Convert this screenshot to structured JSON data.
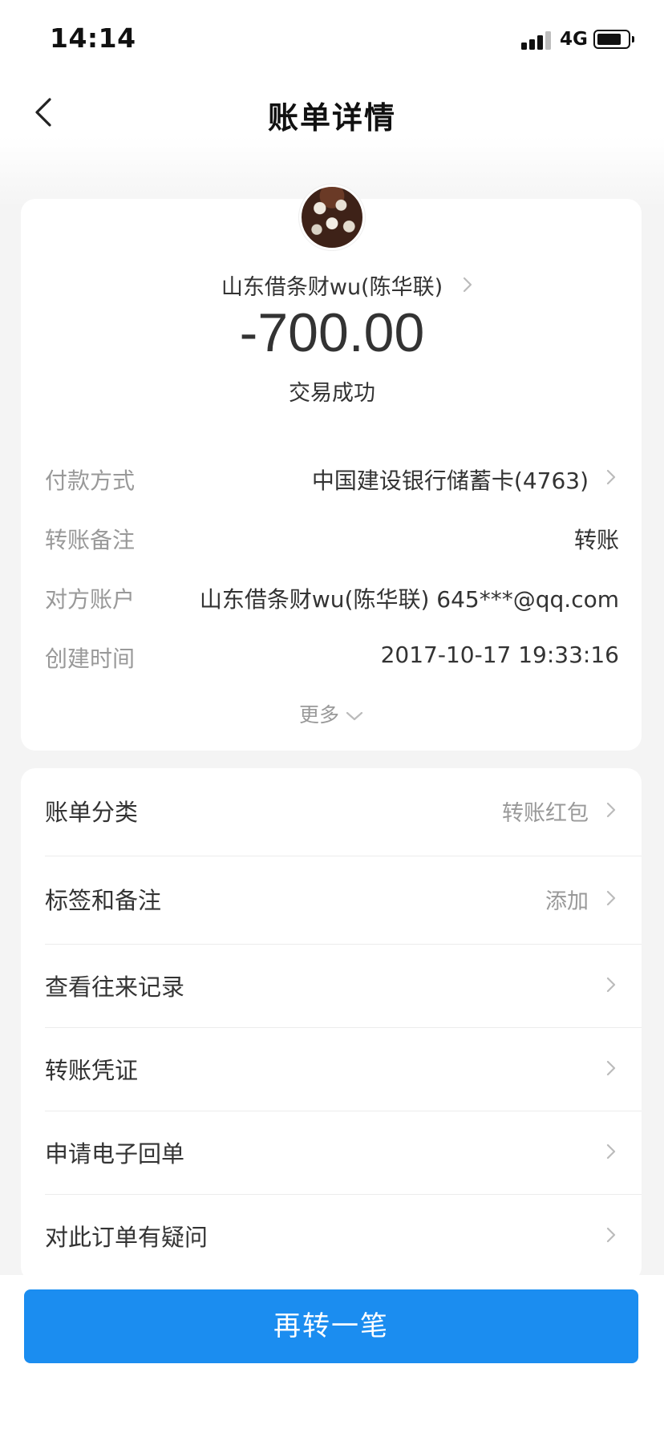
{
  "status_bar": {
    "time": "14:14",
    "network": "4G",
    "battery_icon": "battery-icon",
    "signal_icon": "signal-icon"
  },
  "nav": {
    "title": "账单详情",
    "back_icon": "chevron-left-icon"
  },
  "transaction": {
    "payee": "山东借条财wu(陈华联)",
    "amount": "-700.00",
    "status": "交易成功"
  },
  "details": [
    {
      "label": "付款方式",
      "value": "中国建设银行储蓄卡(4763)",
      "has_chevron": true
    },
    {
      "label": "转账备注",
      "value": "转账",
      "has_chevron": false
    },
    {
      "label": "对方账户",
      "value": "山东借条财wu(陈华联) 645***@qq.com",
      "has_chevron": false
    },
    {
      "label": "创建时间",
      "value": "2017-10-17 19:33:16",
      "has_chevron": false
    }
  ],
  "more_label": "更多",
  "options": [
    {
      "label": "账单分类",
      "value": "转账红包"
    },
    {
      "label": "标签和备注",
      "value": "添加"
    },
    {
      "label": "查看往来记录",
      "value": ""
    },
    {
      "label": "转账凭证",
      "value": ""
    },
    {
      "label": "申请电子回单",
      "value": ""
    },
    {
      "label": "对此订单有疑问",
      "value": ""
    }
  ],
  "cta_label": "再转一笔",
  "colors": {
    "accent": "#1b8df0",
    "muted_text": "#999999",
    "primary_text": "#333333"
  }
}
